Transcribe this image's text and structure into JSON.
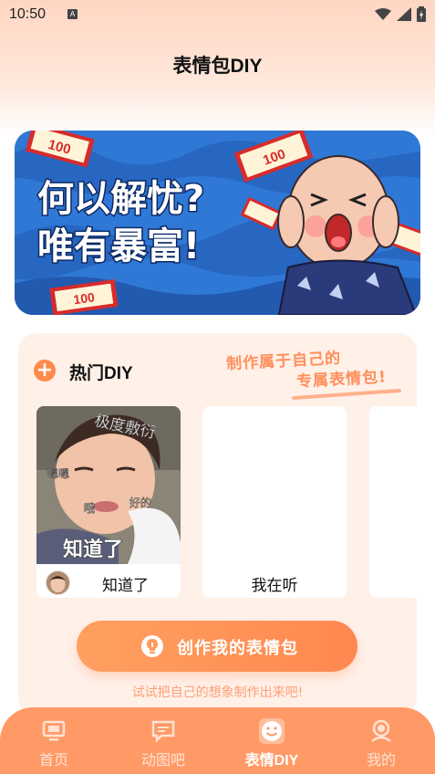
{
  "status_bar": {
    "time": "10:50",
    "notification_letter": "A"
  },
  "header": {
    "title": "表情包DIY"
  },
  "banner": {
    "line1": "何以解忧?",
    "line2": "唯有暴富!",
    "money_label": "100"
  },
  "hot_section": {
    "title": "热门DIY",
    "slogan_line1": "制作属于自己的",
    "slogan_line2": "专属表情包!",
    "items": [
      {
        "label": "知道了",
        "caption_top": "极度敷衍",
        "caption_a": "嗯嗯",
        "caption_b": "哦",
        "caption_c": "好的",
        "caption_main": "知道了"
      },
      {
        "label": "我在听"
      },
      {
        "label": ""
      }
    ],
    "create_button": "创作我的表情包",
    "hint": "试试把自己的想象制作出来吧!"
  },
  "tabbar": {
    "tabs": [
      {
        "label": "首页",
        "icon": "monitor-icon",
        "active": false
      },
      {
        "label": "动图吧",
        "icon": "chat-icon",
        "active": false
      },
      {
        "label": "表情DIY",
        "icon": "smiley-icon",
        "active": true
      },
      {
        "label": "我的",
        "icon": "user-icon",
        "active": false
      }
    ]
  },
  "colors": {
    "accent": "#ff9a66",
    "card_bg": "#fff0e8",
    "banner_blue": "#2a6fd0"
  }
}
